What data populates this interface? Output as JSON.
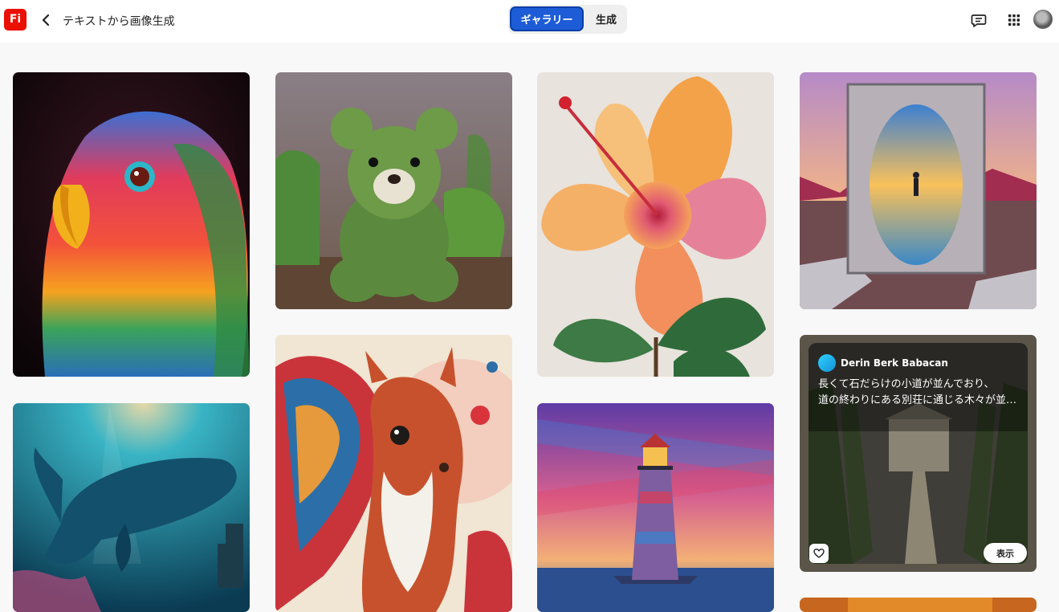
{
  "header": {
    "logo_text": "Fi",
    "title": "テキストから画像生成",
    "tabs": [
      {
        "label": "ギャラリー",
        "active": true
      },
      {
        "label": "生成",
        "active": false
      }
    ],
    "icons": [
      "back-chevron-icon",
      "feedback-icon",
      "apps-grid-icon",
      "avatar"
    ]
  },
  "gallery": {
    "overlay_card": {
      "author": "Derin Berk Babacan",
      "prompt_line1": "長くて石だらけの小道が並んでおり、",
      "prompt_line2": "道の終わりにある別荘に通じる木々が並…",
      "view_label": "表示"
    }
  },
  "colors": {
    "accent": "#1d5cd6",
    "brand_logo": "#eb1000"
  }
}
